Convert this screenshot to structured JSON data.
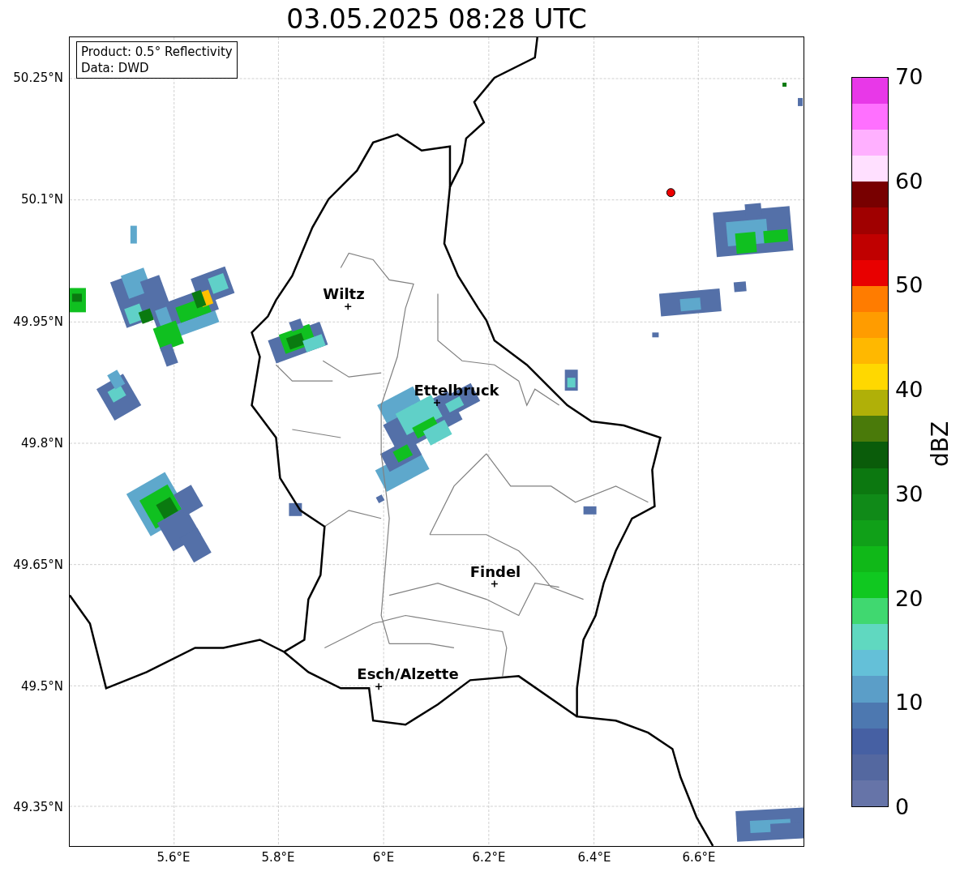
{
  "title": "03.05.2025 08:28 UTC",
  "legend": [
    "Product: 0.5° Reflectivity",
    "Data: DWD"
  ],
  "y_ticks": [
    "50.25°N",
    "50.1°N",
    "49.95°N",
    "49.8°N",
    "49.65°N",
    "49.5°N",
    "49.35°N"
  ],
  "x_ticks": [
    "5.6°E",
    "5.8°E",
    "6°E",
    "6.2°E",
    "6.4°E",
    "6.6°E"
  ],
  "cities": [
    {
      "name": "Wiltz"
    },
    {
      "name": "Ettelbruck"
    },
    {
      "name": "Findel"
    },
    {
      "name": "Esch/Alzette"
    }
  ],
  "colorbar": {
    "label": "dBZ",
    "ticks": [
      "70",
      "60",
      "50",
      "40",
      "30",
      "20",
      "10",
      "0"
    ],
    "bands": [
      {
        "color": "#6674a8"
      },
      {
        "color": "#5468a0"
      },
      {
        "color": "#4660a3"
      },
      {
        "color": "#4d78b0"
      },
      {
        "color": "#5b9ec8"
      },
      {
        "color": "#64c0d8"
      },
      {
        "color": "#60d8c0"
      },
      {
        "color": "#40d870"
      },
      {
        "color": "#10c820"
      },
      {
        "color": "#10b818"
      },
      {
        "color": "#10a018"
      },
      {
        "color": "#108a18"
      },
      {
        "color": "#0c7810"
      },
      {
        "color": "#0a5c0a"
      },
      {
        "color": "#4a7a0a"
      },
      {
        "color": "#b0b008"
      },
      {
        "color": "#ffd800"
      },
      {
        "color": "#ffb800"
      },
      {
        "color": "#ff9c00"
      },
      {
        "color": "#ff7c00"
      },
      {
        "color": "#e80000"
      },
      {
        "color": "#c00000"
      },
      {
        "color": "#a00000"
      },
      {
        "color": "#780000"
      },
      {
        "color": "#ffe0ff"
      },
      {
        "color": "#ffb0ff"
      },
      {
        "color": "#ff70ff"
      },
      {
        "color": "#e838e8"
      }
    ]
  }
}
